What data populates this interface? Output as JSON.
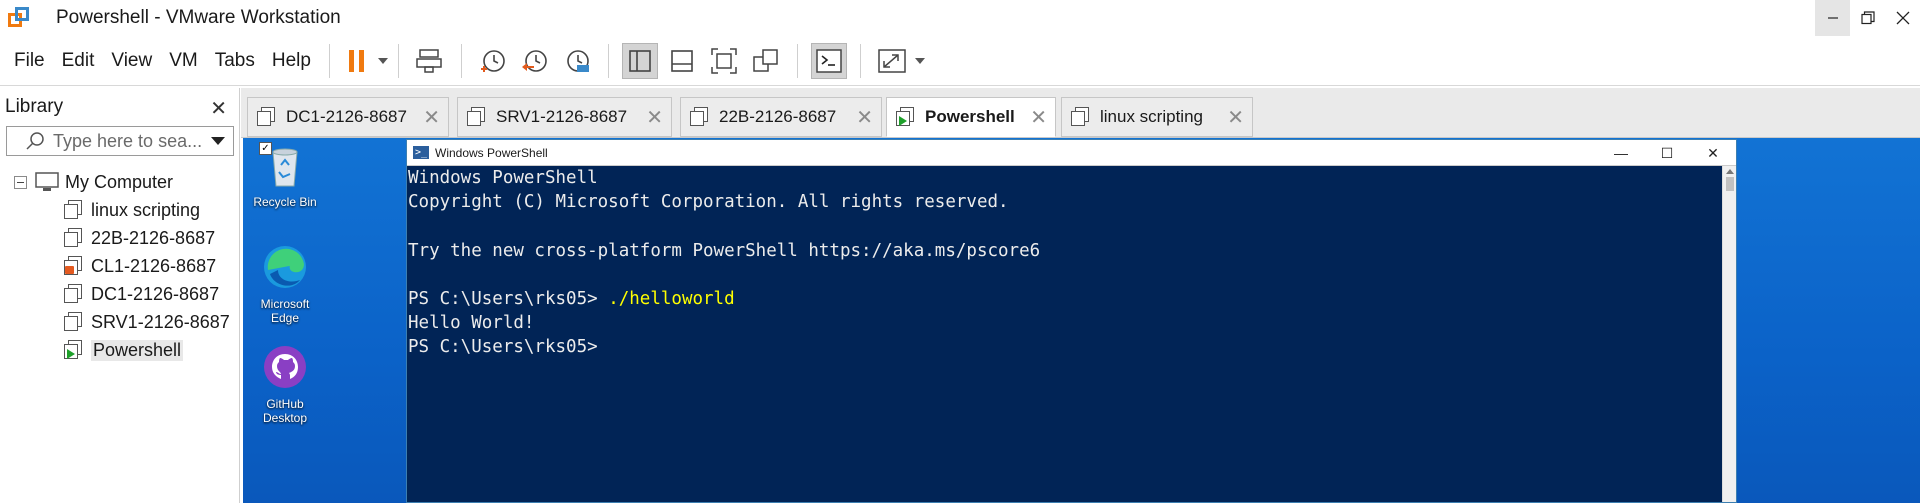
{
  "window": {
    "title": "Powershell - VMware Workstation"
  },
  "menu": {
    "items": [
      "File",
      "Edit",
      "View",
      "VM",
      "Tabs",
      "Help"
    ]
  },
  "library": {
    "title": "Library",
    "search_placeholder": "Type here to sea...",
    "root": "My Computer",
    "items": [
      {
        "label": "linux scripting",
        "state": "off"
      },
      {
        "label": "22B-2126-8687",
        "state": "off"
      },
      {
        "label": "CL1-2126-8687",
        "state": "locked"
      },
      {
        "label": "DC1-2126-8687",
        "state": "off"
      },
      {
        "label": "SRV1-2126-8687",
        "state": "off"
      },
      {
        "label": "Powershell",
        "state": "running"
      }
    ]
  },
  "tabs": [
    {
      "label": "DC1-2126-8687",
      "active": false
    },
    {
      "label": "SRV1-2126-8687",
      "active": false
    },
    {
      "label": "22B-2126-8687",
      "active": false
    },
    {
      "label": "Powershell",
      "active": true
    },
    {
      "label": "linux scripting",
      "active": false
    }
  ],
  "desktop": {
    "icons": [
      {
        "label": "Recycle Bin",
        "icon": "recycle-bin-icon"
      },
      {
        "label": "Microsoft Edge",
        "icon": "edge-icon"
      },
      {
        "label": "GitHub Desktop",
        "icon": "github-desktop-icon"
      }
    ]
  },
  "powershell": {
    "title": "Windows PowerShell",
    "lines": [
      "Windows PowerShell",
      "Copyright (C) Microsoft Corporation. All rights reserved.",
      "",
      "Try the new cross-platform PowerShell https://aka.ms/pscore6",
      "",
      "PS C:\\Users\\rks05> ",
      "Hello World!",
      "PS C:\\Users\\rks05>"
    ],
    "command": "./helloworld"
  },
  "colors": {
    "ps_background": "#012456",
    "desktop": "#0b62c8",
    "pause_accent": "#f07a10"
  }
}
